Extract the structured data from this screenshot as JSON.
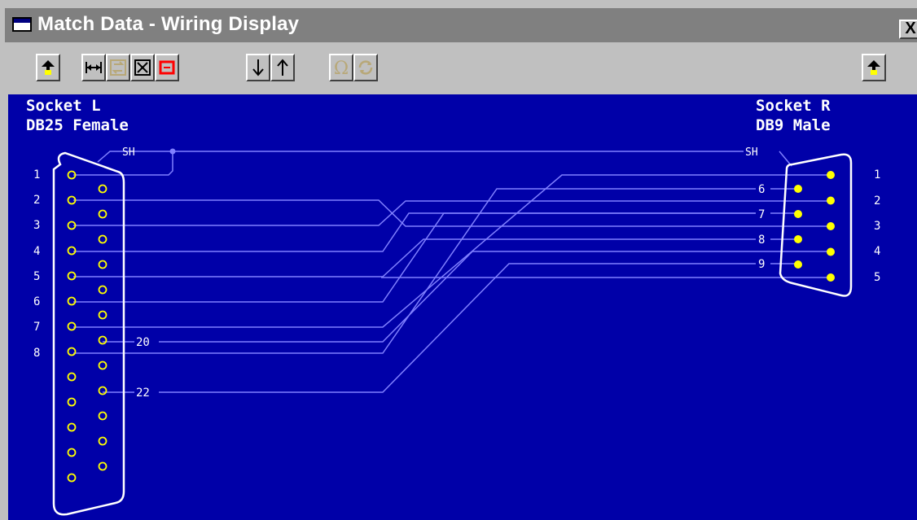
{
  "window": {
    "title": "Match Data - Wiring Display",
    "close_label": "X"
  },
  "toolbar": {
    "buttons": [
      {
        "id": "connector-left",
        "icon": "connector-probe-icon",
        "enabled": true
      },
      {
        "id": "fit-width",
        "icon": "fit-width-icon",
        "enabled": true
      },
      {
        "id": "swap",
        "icon": "swap-icon",
        "enabled": false
      },
      {
        "id": "expand",
        "icon": "expand-icon",
        "enabled": true
      },
      {
        "id": "frame",
        "icon": "frame-red-icon",
        "enabled": true
      },
      {
        "id": "move-down",
        "icon": "arrow-down-icon",
        "enabled": true
      },
      {
        "id": "move-up",
        "icon": "arrow-up-icon",
        "enabled": true
      },
      {
        "id": "ohm",
        "icon": "ohm-icon",
        "enabled": false
      },
      {
        "id": "refresh",
        "icon": "refresh-icon",
        "enabled": false
      },
      {
        "id": "connector-right",
        "icon": "connector-probe-icon",
        "enabled": true
      }
    ]
  },
  "left_socket": {
    "name": "Socket L",
    "type": "DB25 Female",
    "pin_rows": [
      13,
      12
    ]
  },
  "right_socket": {
    "name": "Socket R",
    "type": "DB9 Male",
    "pin_rows": [
      5,
      4
    ]
  },
  "left_pin_labels": [
    "1",
    "2",
    "3",
    "4",
    "5",
    "6",
    "7",
    "8"
  ],
  "right_pin_labels": [
    "1",
    "2",
    "3",
    "4",
    "5"
  ],
  "wire_labels": {
    "shield_left": "SH",
    "shield_right": "SH",
    "pin20": "20",
    "pin22": "22",
    "r6": "6",
    "r7": "7",
    "r8": "8",
    "r9": "9"
  },
  "connections": [
    [
      "L1",
      "SH"
    ],
    [
      "L2",
      "R3"
    ],
    [
      "L3",
      "R2"
    ],
    [
      "L4",
      "R8"
    ],
    [
      "L5",
      "R7"
    ],
    [
      "L6",
      "R6"
    ],
    [
      "L7",
      "R1"
    ],
    [
      "L20",
      "R4"
    ],
    [
      "L8",
      "R5"
    ],
    [
      "L22",
      "R9"
    ]
  ],
  "colors": {
    "background": "#0000A8",
    "wire": "#8080FF",
    "outline": "#FFFFFF",
    "female_pin": "#FFFF00",
    "male_pin": "#FFFF00"
  }
}
